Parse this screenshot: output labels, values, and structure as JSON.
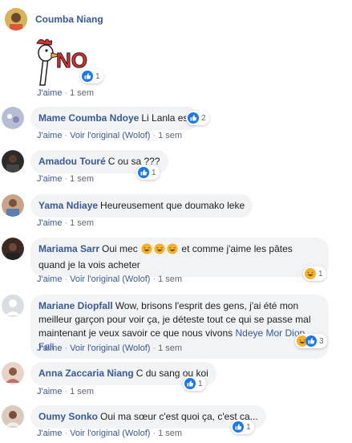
{
  "comments": [
    {
      "author": "Coumba Niang",
      "sticker_text": "NO",
      "reaction": {
        "icons": [
          "like-icon"
        ],
        "count": "1"
      },
      "actions": {
        "like": "J'aime",
        "time": "1 sem"
      }
    },
    {
      "author": "Mame Coumba Ndoye",
      "text": "Li Lanla est",
      "reaction": {
        "icons": [
          "like-icon"
        ],
        "count": "2"
      },
      "actions": {
        "like": "J'aime",
        "translate": "Voir l'original (Wolof)",
        "time": "1 sem"
      }
    },
    {
      "author": "Amadou Touré",
      "text": "C ou sa ???",
      "reaction": {
        "icons": [
          "like-icon"
        ],
        "count": "1"
      },
      "actions": {
        "like": "J'aime",
        "time": "1 sem"
      }
    },
    {
      "author": "Yama Ndiaye",
      "text": "Heureusement que doumako leke",
      "actions": {
        "like": "J'aime",
        "time": "1 sem"
      }
    },
    {
      "author": "Mariama Sarr",
      "text_before": "Oui mec",
      "text_after": "et comme j'aime les pâtes quand je la vois acheter",
      "inline_emojis": [
        "laughing-emoji",
        "laughing-emoji",
        "laughing-emoji"
      ],
      "reaction": {
        "icons": [
          "haha-icon"
        ],
        "count": "1"
      },
      "actions": {
        "like": "J'aime",
        "translate": "Voir l'original (Wolof)",
        "time": "1 sem"
      }
    },
    {
      "author": "Mariane Diopfall",
      "text": "Wow, brisons l'esprit des gens, j'ai été mon meilleur garçon pour voir ça, je déteste tout ce qui se passe mal maintenant je veux savoir ce que nous vivons",
      "mention": "Ndeye Mor Diop Fall",
      "reaction": {
        "icons": [
          "haha-icon",
          "like-icon"
        ],
        "count": "3"
      },
      "actions": {
        "like": "J'aime",
        "translate": "Voir l'original (Wolof)",
        "time": "1 sem"
      }
    },
    {
      "author": "Anna Zaccaria Niang",
      "text": "C du sang ou koi",
      "reaction": {
        "icons": [
          "like-icon"
        ],
        "count": "1"
      },
      "actions": {
        "like": "J'aime",
        "time": "1 sem"
      }
    },
    {
      "author": "Oumy Sonko",
      "text": "Oui ma sœur c'est quoi ça, c'est ça...",
      "reaction": {
        "icons": [
          "like-icon"
        ],
        "count": "1"
      },
      "actions": {
        "like": "J'aime",
        "translate": "Voir l'original (Wolof)",
        "time": "1 sem"
      }
    }
  ],
  "colors": {
    "link": "#385898",
    "bubble": "#f2f3f5",
    "like": "#1877f2",
    "haha": "#f7b125",
    "meta": "#606770"
  }
}
